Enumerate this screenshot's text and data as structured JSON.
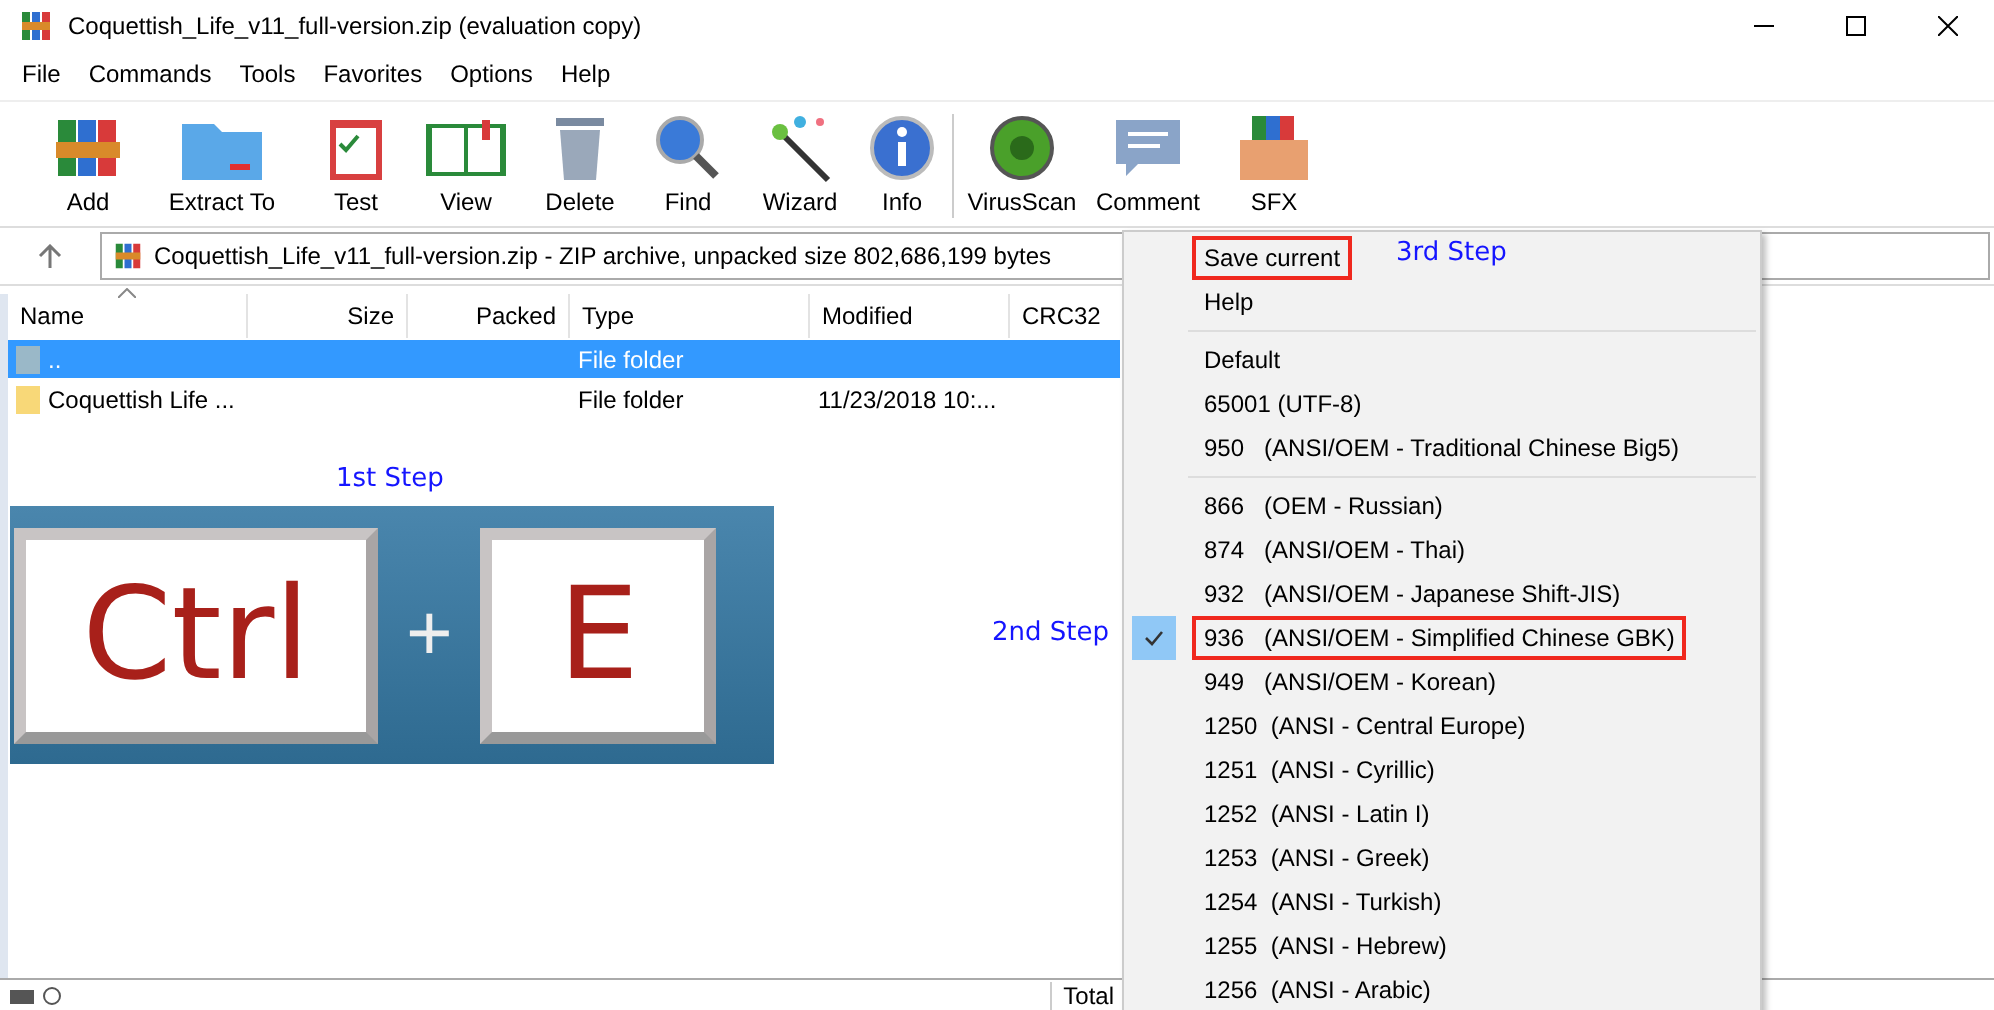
{
  "window": {
    "title": "Coquettish_Life_v11_full-version.zip (evaluation copy)"
  },
  "menu_bar": [
    "File",
    "Commands",
    "Tools",
    "Favorites",
    "Options",
    "Help"
  ],
  "toolbar": [
    {
      "label": "Add"
    },
    {
      "label": "Extract To"
    },
    {
      "label": "Test"
    },
    {
      "label": "View"
    },
    {
      "label": "Delete"
    },
    {
      "label": "Find"
    },
    {
      "label": "Wizard"
    },
    {
      "label": "Info"
    },
    {
      "label": "VirusScan"
    },
    {
      "label": "Comment"
    },
    {
      "label": "SFX"
    }
  ],
  "address": "Coquettish_Life_v11_full-version.zip - ZIP archive, unpacked size 802,686,199 bytes",
  "table": {
    "columns": [
      "Name",
      "Size",
      "Packed",
      "Type",
      "Modified",
      "CRC32"
    ],
    "rows": [
      {
        "cells": [
          "..",
          "",
          "",
          "File folder",
          "",
          ""
        ],
        "selected": true
      },
      {
        "cells": [
          "Coquettish Life ...",
          "",
          "",
          "File folder",
          "11/23/2018 10:...",
          ""
        ],
        "selected": false
      }
    ]
  },
  "status_bar": {
    "text": "Total"
  },
  "shortcut_graphic": {
    "keys": [
      "Ctrl",
      "E"
    ],
    "joiner": "+"
  },
  "annotations": [
    "1st Step",
    "2nd Step",
    "3rd Step"
  ],
  "context_menu": [
    {
      "kind": "item",
      "label": "Save current",
      "checked": false,
      "highlighted": true
    },
    {
      "kind": "item",
      "label": "Help",
      "checked": false,
      "highlighted": false
    },
    {
      "kind": "separator"
    },
    {
      "kind": "item",
      "label": "Default",
      "checked": false,
      "highlighted": false
    },
    {
      "kind": "item",
      "label": "65001 (UTF-8)",
      "checked": false,
      "highlighted": false
    },
    {
      "kind": "item",
      "label": "950   (ANSI/OEM - Traditional Chinese Big5)",
      "checked": false,
      "highlighted": false
    },
    {
      "kind": "separator"
    },
    {
      "kind": "item",
      "label": "866   (OEM - Russian)",
      "checked": false,
      "highlighted": false
    },
    {
      "kind": "item",
      "label": "874   (ANSI/OEM - Thai)",
      "checked": false,
      "highlighted": false
    },
    {
      "kind": "item",
      "label": "932   (ANSI/OEM - Japanese Shift-JIS)",
      "checked": false,
      "highlighted": false
    },
    {
      "kind": "item",
      "label": "936   (ANSI/OEM - Simplified Chinese GBK)",
      "checked": true,
      "highlighted": true
    },
    {
      "kind": "item",
      "label": "949   (ANSI/OEM - Korean)",
      "checked": false,
      "highlighted": false
    },
    {
      "kind": "item",
      "label": "1250  (ANSI - Central Europe)",
      "checked": false,
      "highlighted": false
    },
    {
      "kind": "item",
      "label": "1251  (ANSI - Cyrillic)",
      "checked": false,
      "highlighted": false
    },
    {
      "kind": "item",
      "label": "1252  (ANSI - Latin I)",
      "checked": false,
      "highlighted": false
    },
    {
      "kind": "item",
      "label": "1253  (ANSI - Greek)",
      "checked": false,
      "highlighted": false
    },
    {
      "kind": "item",
      "label": "1254  (ANSI - Turkish)",
      "checked": false,
      "highlighted": false
    },
    {
      "kind": "item",
      "label": "1255  (ANSI - Hebrew)",
      "checked": false,
      "highlighted": false
    },
    {
      "kind": "item",
      "label": "1256  (ANSI - Arabic)",
      "checked": false,
      "highlighted": false
    }
  ]
}
